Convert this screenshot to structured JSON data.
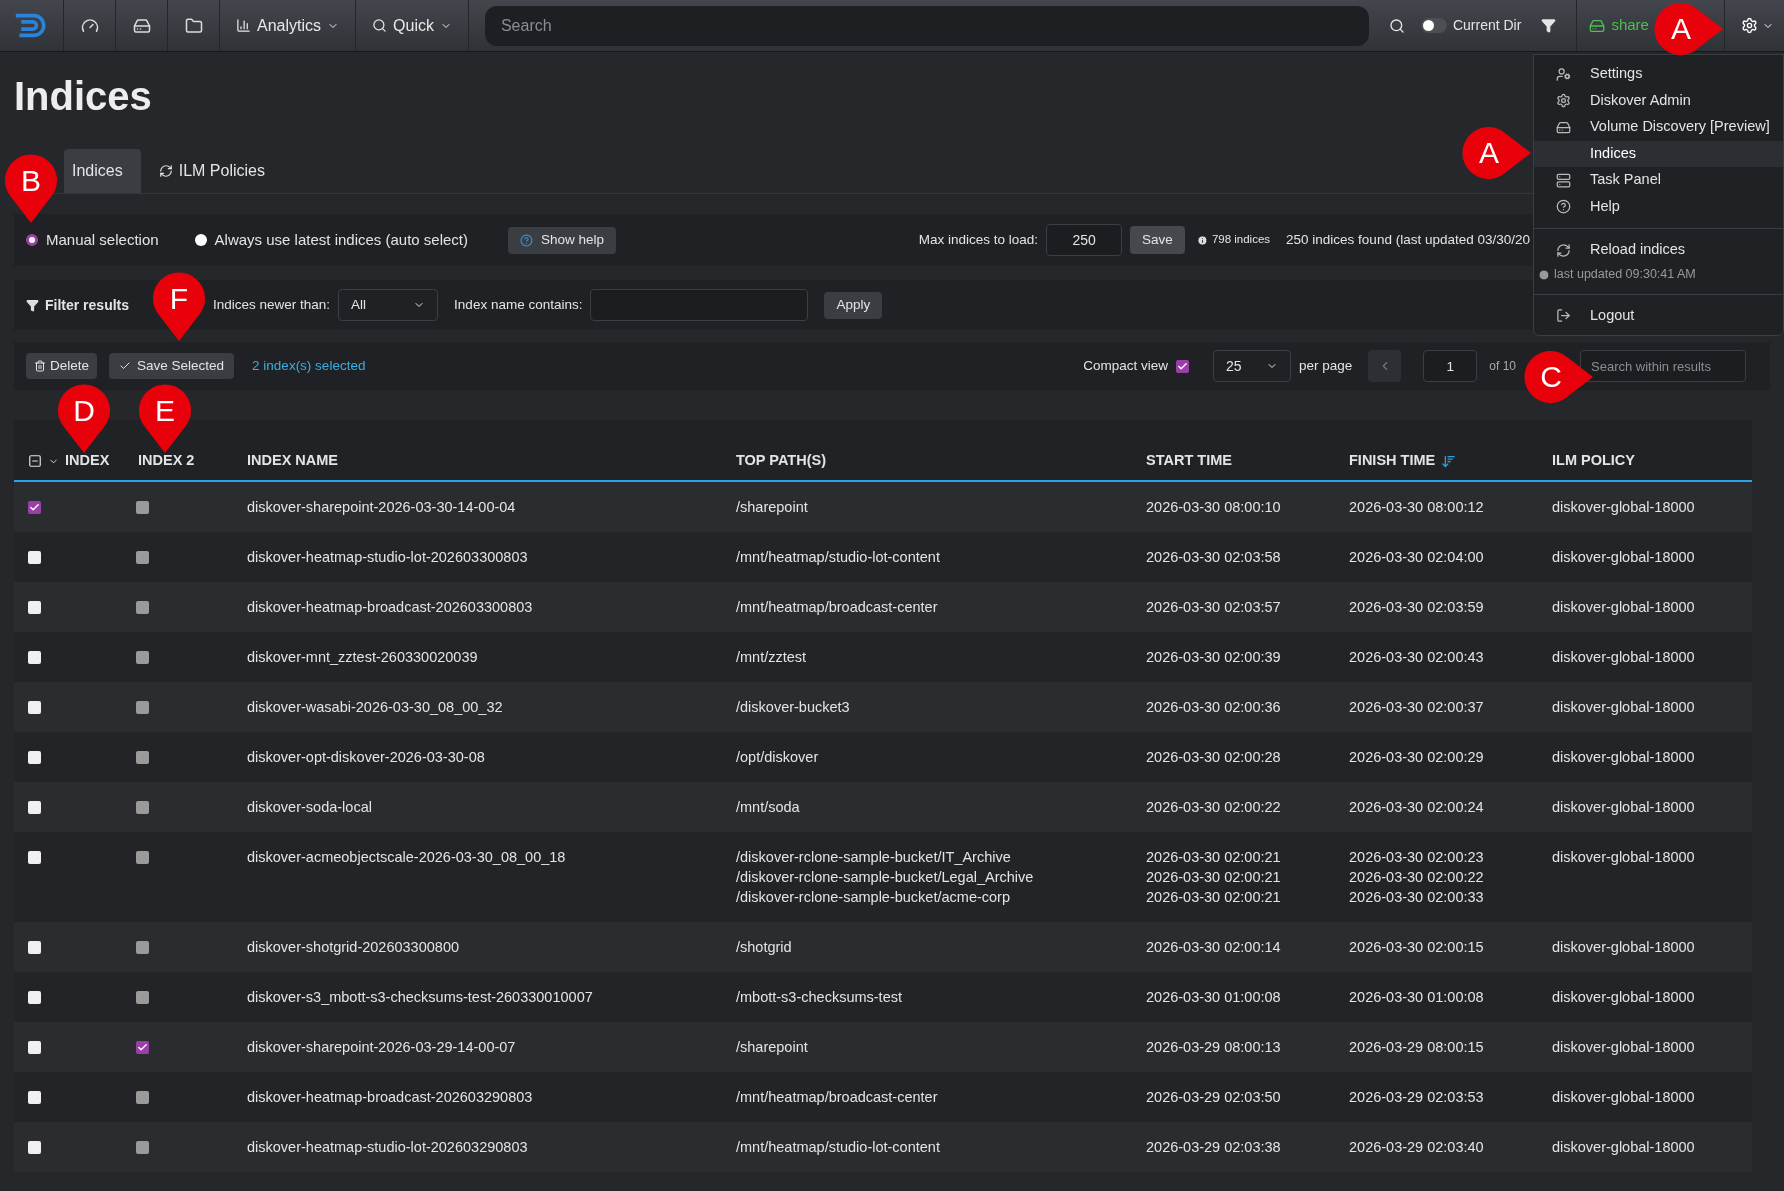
{
  "topbar": {
    "nav": [
      {
        "kind": "logo"
      },
      {
        "kind": "icon"
      },
      {
        "kind": "icon"
      },
      {
        "kind": "icon"
      },
      {
        "kind": "menu",
        "label": "Analytics"
      },
      {
        "kind": "menu",
        "label": "Quick"
      }
    ],
    "search": {
      "placeholder": "Search"
    },
    "current_dir": {
      "label": "Current Dir",
      "on": false
    },
    "share": "share"
  },
  "user_menu": {
    "items": [
      {
        "kind": "item",
        "label": "Settings",
        "selected": false
      },
      {
        "kind": "item",
        "label": "Diskover Admin",
        "selected": false
      },
      {
        "kind": "item",
        "label": "Volume Discovery [Preview]",
        "selected": false
      },
      {
        "kind": "item",
        "label": "Indices",
        "selected": true
      },
      {
        "kind": "item",
        "label": "Task Panel",
        "selected": false
      },
      {
        "kind": "item",
        "label": "Help",
        "selected": false
      },
      {
        "kind": "divider"
      },
      {
        "kind": "item",
        "label": "Reload indices",
        "selected": false
      },
      {
        "kind": "note",
        "label": "last updated 09:30:41 AM"
      },
      {
        "kind": "divider"
      },
      {
        "kind": "item",
        "label": "Logout",
        "selected": false
      }
    ]
  },
  "page_title": "Indices",
  "tabs": [
    {
      "label": "Indices",
      "selected": true
    },
    {
      "label": "ILM Policies",
      "selected": false
    }
  ],
  "selection_mode": {
    "options": [
      {
        "label": "Manual selection",
        "selected": true
      },
      {
        "label": "Always use latest indices (auto select)",
        "selected": false
      }
    ],
    "help_button": "Show help",
    "max_label": "Max indices to load:",
    "max_value": "250",
    "save_button": "Save",
    "total": "798 indices",
    "found": "250 indices found (last updated 03/30/20"
  },
  "filter": {
    "title": "Filter results",
    "newer_label": "Indices newer than:",
    "newer_value": "All",
    "name_label": "Index name contains:",
    "apply_button": "Apply"
  },
  "actions": {
    "delete_button": "Delete",
    "save_selected_button": "Save Selected",
    "selected_count": "2 index(s) selected",
    "compact_label": "Compact view",
    "compact": true,
    "per_page_value": "25",
    "per_page_label": "per page",
    "page_value": "1",
    "of_pages": "of 10",
    "search_placeholder": "Search within results"
  },
  "table": {
    "columns": [
      "INDEX",
      "INDEX 2",
      "INDEX NAME",
      "TOP PATH(S)",
      "START TIME",
      "FINISH TIME",
      "ILM POLICY"
    ],
    "rows": [
      {
        "index": true,
        "index2": false,
        "name": "diskover-sharepoint-2026-03-30-14-00-04",
        "paths": [
          "/sharepoint"
        ],
        "start": [
          "2026-03-30 08:00:10"
        ],
        "finish": [
          "2026-03-30 08:00:12"
        ],
        "policy": "diskover-global-18000"
      },
      {
        "index": false,
        "index2": false,
        "name": "diskover-heatmap-studio-lot-202603300803",
        "paths": [
          "/mnt/heatmap/studio-lot-content"
        ],
        "start": [
          "2026-03-30 02:03:58"
        ],
        "finish": [
          "2026-03-30 02:04:00"
        ],
        "policy": "diskover-global-18000"
      },
      {
        "index": false,
        "index2": false,
        "name": "diskover-heatmap-broadcast-202603300803",
        "paths": [
          "/mnt/heatmap/broadcast-center"
        ],
        "start": [
          "2026-03-30 02:03:57"
        ],
        "finish": [
          "2026-03-30 02:03:59"
        ],
        "policy": "diskover-global-18000"
      },
      {
        "index": false,
        "index2": false,
        "name": "diskover-mnt_zztest-260330020039",
        "paths": [
          "/mnt/zztest"
        ],
        "start": [
          "2026-03-30 02:00:39"
        ],
        "finish": [
          "2026-03-30 02:00:43"
        ],
        "policy": "diskover-global-18000"
      },
      {
        "index": false,
        "index2": false,
        "name": "diskover-wasabi-2026-03-30_08_00_32",
        "paths": [
          "/diskover-bucket3"
        ],
        "start": [
          "2026-03-30 02:00:36"
        ],
        "finish": [
          "2026-03-30 02:00:37"
        ],
        "policy": "diskover-global-18000"
      },
      {
        "index": false,
        "index2": false,
        "name": "diskover-opt-diskover-2026-03-30-08",
        "paths": [
          "/opt/diskover"
        ],
        "start": [
          "2026-03-30 02:00:28"
        ],
        "finish": [
          "2026-03-30 02:00:29"
        ],
        "policy": "diskover-global-18000"
      },
      {
        "index": false,
        "index2": false,
        "name": "diskover-soda-local",
        "paths": [
          "/mnt/soda"
        ],
        "start": [
          "2026-03-30 02:00:22"
        ],
        "finish": [
          "2026-03-30 02:00:24"
        ],
        "policy": "diskover-global-18000"
      },
      {
        "index": false,
        "index2": false,
        "name": "diskover-acmeobjectscale-2026-03-30_08_00_18",
        "paths": [
          "/diskover-rclone-sample-bucket/IT_Archive",
          "/diskover-rclone-sample-bucket/Legal_Archive",
          "/diskover-rclone-sample-bucket/acme-corp"
        ],
        "start": [
          "2026-03-30 02:00:21",
          "2026-03-30 02:00:21",
          "2026-03-30 02:00:21"
        ],
        "finish": [
          "2026-03-30 02:00:23",
          "2026-03-30 02:00:22",
          "2026-03-30 02:00:33"
        ],
        "policy": "diskover-global-18000"
      },
      {
        "index": false,
        "index2": false,
        "name": "diskover-shotgrid-202603300800",
        "paths": [
          "/shotgrid"
        ],
        "start": [
          "2026-03-30 02:00:14"
        ],
        "finish": [
          "2026-03-30 02:00:15"
        ],
        "policy": "diskover-global-18000"
      },
      {
        "index": false,
        "index2": false,
        "name": "diskover-s3_mbott-s3-checksums-test-260330010007",
        "paths": [
          "/mbott-s3-checksums-test"
        ],
        "start": [
          "2026-03-30 01:00:08"
        ],
        "finish": [
          "2026-03-30 01:00:08"
        ],
        "policy": "diskover-global-18000"
      },
      {
        "index": false,
        "index2": true,
        "name": "diskover-sharepoint-2026-03-29-14-00-07",
        "paths": [
          "/sharepoint"
        ],
        "start": [
          "2026-03-29 08:00:13"
        ],
        "finish": [
          "2026-03-29 08:00:15"
        ],
        "policy": "diskover-global-18000"
      },
      {
        "index": false,
        "index2": false,
        "name": "diskover-heatmap-broadcast-202603290803",
        "paths": [
          "/mnt/heatmap/broadcast-center"
        ],
        "start": [
          "2026-03-29 02:03:50"
        ],
        "finish": [
          "2026-03-29 02:03:53"
        ],
        "policy": "diskover-global-18000"
      },
      {
        "index": false,
        "index2": false,
        "name": "diskover-heatmap-studio-lot-202603290803",
        "paths": [
          "/mnt/heatmap/studio-lot-content"
        ],
        "start": [
          "2026-03-29 02:03:38"
        ],
        "finish": [
          "2026-03-29 02:03:40"
        ],
        "policy": "diskover-global-18000"
      }
    ]
  },
  "annotations": [
    {
      "label": "A"
    },
    {
      "label": "A"
    },
    {
      "label": "B"
    },
    {
      "label": "C"
    },
    {
      "label": "D"
    },
    {
      "label": "E"
    },
    {
      "label": "F"
    }
  ]
}
